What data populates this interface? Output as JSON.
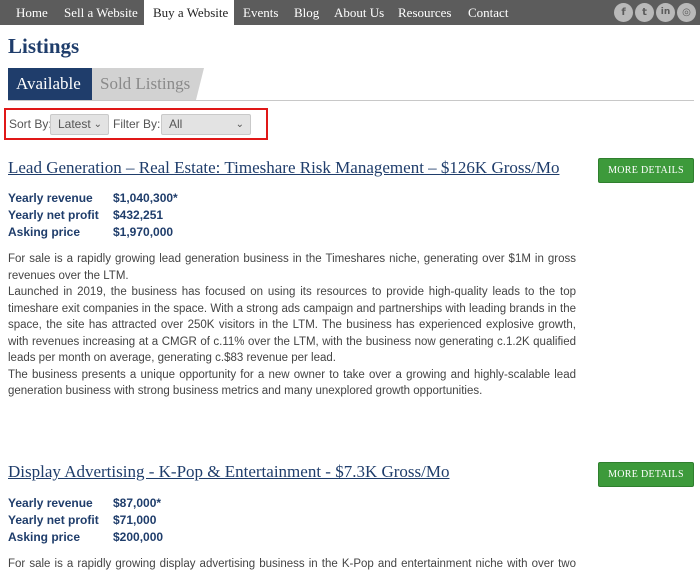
{
  "nav": {
    "items": [
      "Home",
      "Sell a Website",
      "Buy a Website",
      "Events",
      "Blog",
      "About Us",
      "Resources",
      "Contact"
    ],
    "active": "Buy a Website",
    "social": [
      {
        "icon": "facebook-icon",
        "glyph": "f"
      },
      {
        "icon": "twitter-icon",
        "glyph": "t"
      },
      {
        "icon": "linkedin-icon",
        "glyph": "in"
      },
      {
        "icon": "instagram-icon",
        "glyph": "◎"
      }
    ]
  },
  "page": {
    "title": "Listings"
  },
  "tabs": {
    "available": "Available",
    "sold": "Sold Listings"
  },
  "controls": {
    "sort_label": "Sort By:",
    "sort_value": "Latest",
    "filter_label": "Filter By:",
    "filter_value": "All",
    "highlight_color": "#e01818"
  },
  "listings": [
    {
      "title": "Lead Generation – Real Estate: Timeshare Risk Management – $126K Gross/Mo",
      "button": "MORE DETAILS",
      "stats": [
        {
          "label": "Yearly revenue",
          "value": "$1,040,300*"
        },
        {
          "label": "Yearly net profit",
          "value": "$432,251"
        },
        {
          "label": "Asking price",
          "value": "$1,970,000"
        }
      ],
      "paragraphs": [
        "For sale is a rapidly growing lead generation business in the Timeshares niche, generating over $1M in gross revenues over the LTM.",
        "Launched in 2019, the business has focused on using its resources to provide high-quality leads to the top timeshare exit companies in the space. With a strong ads campaign and partnerships with leading brands in the space, the site has attracted over 250K visitors in the LTM. The business has experienced explosive growth, with revenues increasing at a CMGR of c.11% over the LTM, with the business now generating c.1.2K qualified leads per month on average, generating c.$83 revenue per lead.",
        "The business presents a unique opportunity for a new owner to take over a growing and highly-scalable lead generation business with strong business metrics and many unexplored growth opportunities."
      ]
    },
    {
      "title": "Display Advertising - K-Pop & Entertainment - $7.3K Gross/Mo",
      "button": "MORE DETAILS",
      "stats": [
        {
          "label": "Yearly revenue",
          "value": "$87,000*"
        },
        {
          "label": "Yearly net profit",
          "value": "$71,000"
        },
        {
          "label": "Asking price",
          "value": "$200,000"
        }
      ],
      "paragraphs": [
        "For sale is a rapidly growing display advertising business in the K-Pop and entertainment niche with over two years"
      ]
    }
  ],
  "colors": {
    "nav_bg": "#5c5c5c",
    "brand_navy": "#1f3d6b",
    "button_green": "#3d9a3b"
  }
}
